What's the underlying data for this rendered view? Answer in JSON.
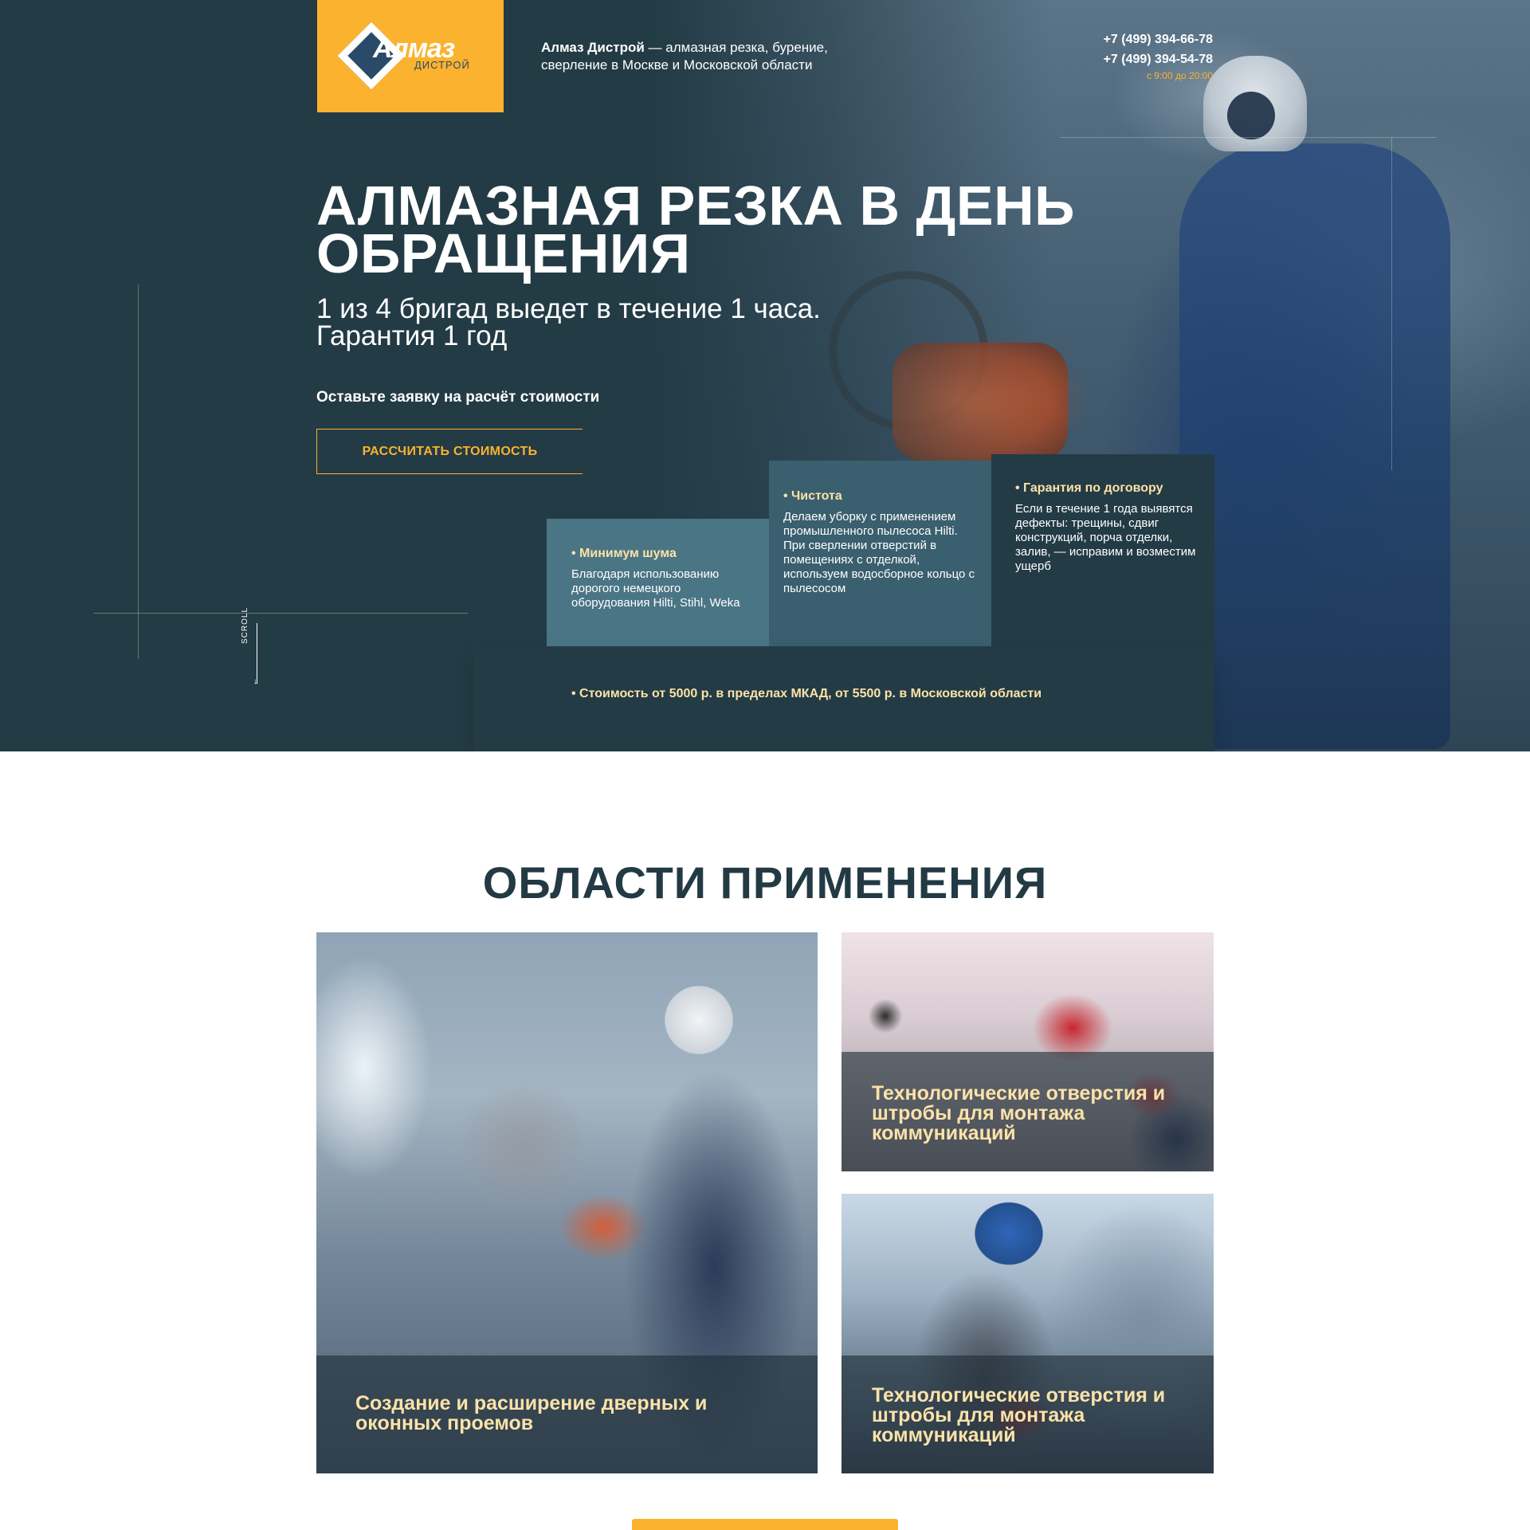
{
  "header": {
    "logo_name": "Алмаз",
    "logo_sub": "ДИСТРОЙ",
    "tagline_brand": "Алмаз Дистрой",
    "tagline_rest": " — алмазная резка, бурение, сверление в Москве и Московской области",
    "phones": [
      "+7 (499) 394-66-78",
      "+7 (499) 394-54-78"
    ],
    "hours": "с 9:00 до 20:00"
  },
  "hero": {
    "title": "АЛМАЗНАЯ РЕЗКА В ДЕНЬ ОБРАЩЕНИЯ",
    "subtitle_line1": "1 из 4 бригад выедет в течение 1 часа.",
    "subtitle_line2": "Гарантия 1 год",
    "cta_text": "Оставьте заявку на расчёт стоимости",
    "cta_button": "РАССЧИТАТЬ СТОИМОСТЬ",
    "scroll_label": "SCROLL"
  },
  "features": [
    {
      "title": "• Минимум шума",
      "text": "Благодаря использованию дорогого немецкого оборудования Hilti, Stihl, Weka"
    },
    {
      "title": "• Чистота",
      "text": "Делаем уборку с применением промышленного пылесоса Hilti. При сверлении отверстий в помещениях с отделкой, используем водосборное кольцо с пылесосом"
    },
    {
      "title": "• Гарантия по договору",
      "text": "Если в течение 1 года выявятся дефекты: трещины, сдвиг конструкций, порча отделки, залив, — исправим и возместим ущерб"
    }
  ],
  "price_note": "• Стоимость от 5000 р. в пределах МКАД, от 5500 р. в Московской области",
  "applications": {
    "title": "ОБЛАСТИ ПРИМЕНЕНИЯ",
    "cards": [
      {
        "label": "Создание и расширение дверных и оконных проемов"
      },
      {
        "label": "Технологические отверстия и штробы для монтажа коммуникаций"
      },
      {
        "label": "Технологические отверстия и штробы для монтажа коммуникаций"
      }
    ]
  },
  "colors": {
    "accent": "#fbb22e",
    "dark": "#233b45",
    "feature_highlight": "#fbe2a8"
  }
}
